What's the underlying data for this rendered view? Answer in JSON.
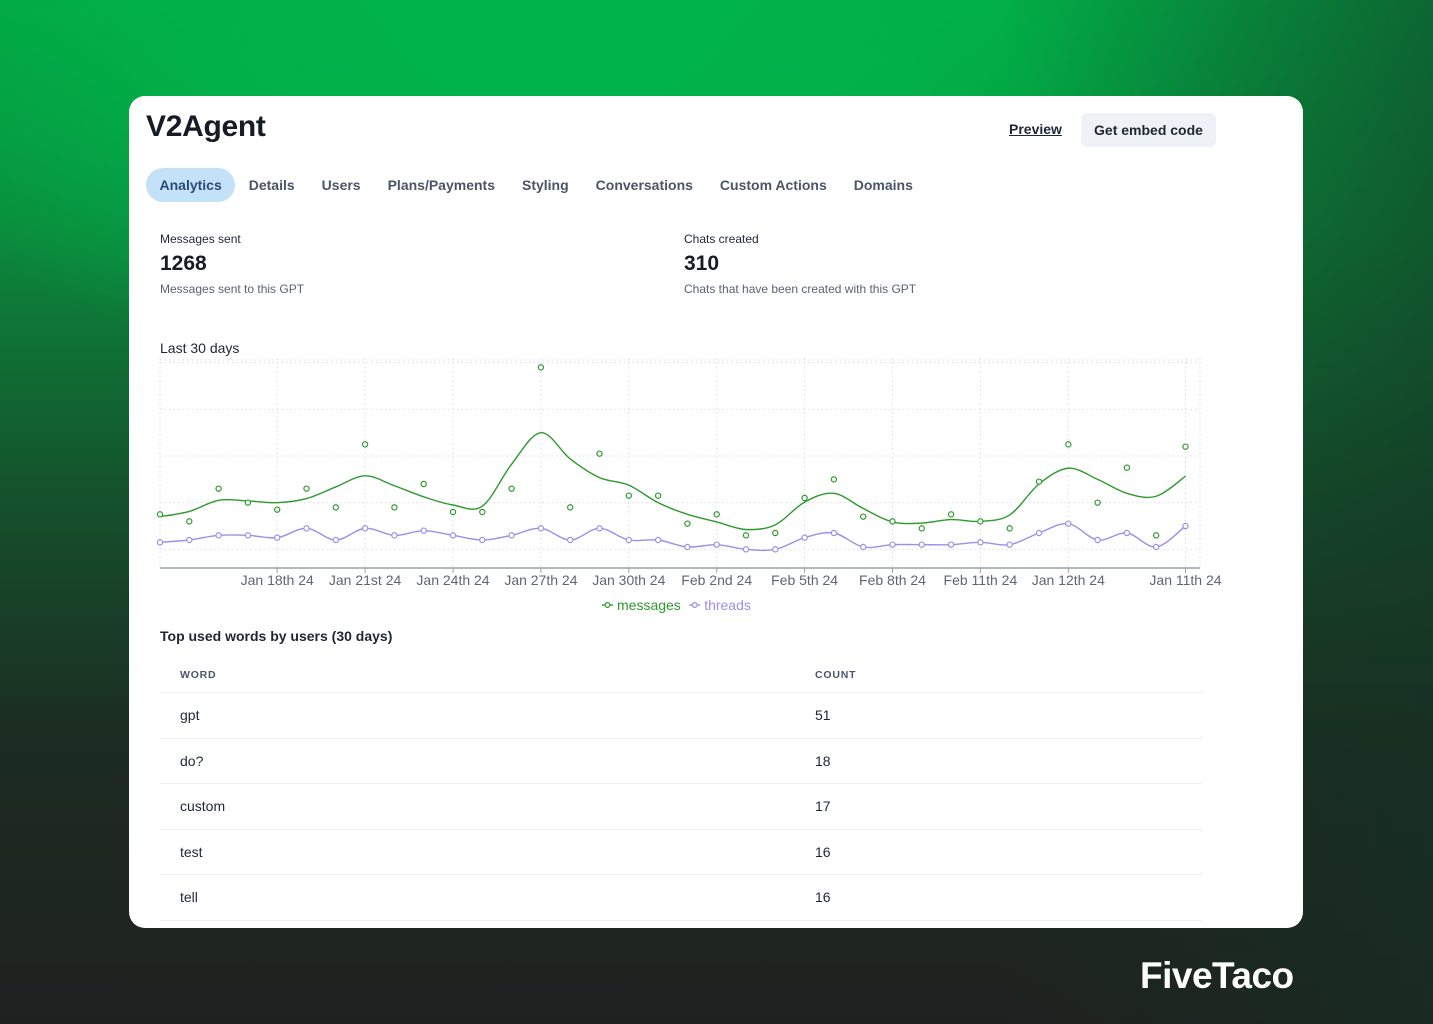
{
  "app": {
    "title": "V2Agent",
    "preview_label": "Preview",
    "embed_label": "Get embed code"
  },
  "tabs": [
    {
      "label": "Analytics",
      "active": true
    },
    {
      "label": "Details",
      "active": false
    },
    {
      "label": "Users",
      "active": false
    },
    {
      "label": "Plans/Payments",
      "active": false
    },
    {
      "label": "Styling",
      "active": false
    },
    {
      "label": "Conversations",
      "active": false
    },
    {
      "label": "Custom Actions",
      "active": false
    },
    {
      "label": "Domains",
      "active": false
    }
  ],
  "stats": {
    "messages": {
      "label": "Messages sent",
      "value": "1268",
      "description": "Messages sent to this GPT"
    },
    "chats": {
      "label": "Chats created",
      "value": "310",
      "description": "Chats that have been created with this GPT"
    }
  },
  "chart_data": {
    "type": "line",
    "title": "Last 30 days",
    "xlabel": "",
    "ylabel": "",
    "grid": true,
    "legend_position": "bottom-center",
    "x_index": [
      0,
      1,
      2,
      3,
      4,
      5,
      6,
      7,
      8,
      9,
      10,
      11,
      12,
      13,
      14,
      15,
      16,
      17,
      18,
      19,
      20,
      21,
      22,
      23,
      24,
      25,
      26,
      27,
      28,
      29,
      30,
      31,
      32,
      33,
      34,
      35
    ],
    "tick_labels": [
      {
        "index": 4,
        "label": "Jan 18th 24"
      },
      {
        "index": 7,
        "label": "Jan 21st 24"
      },
      {
        "index": 10,
        "label": "Jan 24th 24"
      },
      {
        "index": 13,
        "label": "Jan 27th 24"
      },
      {
        "index": 16,
        "label": "Jan 30th 24"
      },
      {
        "index": 19,
        "label": "Feb 2nd 24"
      },
      {
        "index": 22,
        "label": "Feb 5th 24"
      },
      {
        "index": 25,
        "label": "Feb 8th 24"
      },
      {
        "index": 28,
        "label": "Feb 11th 24"
      },
      {
        "index": 31,
        "label": "Jan 12th 24"
      },
      {
        "index": 35,
        "label": "Jan 11th 24"
      }
    ],
    "ylim": [
      0,
      90
    ],
    "y_grid_step": 20,
    "series": [
      {
        "name": "messages",
        "color": "#2e9a2e",
        "smoothed": true,
        "values": [
          23,
          20,
          34,
          28,
          25,
          34,
          26,
          53,
          26,
          36,
          24,
          24,
          34,
          86,
          26,
          49,
          31,
          31,
          19,
          23,
          14,
          15,
          30,
          38,
          22,
          20,
          17,
          23,
          20,
          17,
          37,
          53,
          28,
          43,
          14,
          52
        ]
      },
      {
        "name": "threads",
        "color": "#9b8fe8",
        "smoothed": false,
        "values": [
          11,
          12,
          14,
          14,
          13,
          17,
          12,
          17,
          14,
          16,
          14,
          12,
          14,
          17,
          12,
          17,
          12,
          12,
          9,
          10,
          8,
          8,
          13,
          15,
          9,
          10,
          10,
          10,
          11,
          10,
          15,
          19,
          12,
          15,
          9,
          18
        ]
      }
    ]
  },
  "top_words": {
    "title": "Top used words by users (30 days)",
    "columns": [
      "WORD",
      "COUNT"
    ],
    "rows": [
      {
        "word": "gpt",
        "count": "51"
      },
      {
        "word": "do?",
        "count": "18"
      },
      {
        "word": "custom",
        "count": "17"
      },
      {
        "word": "test",
        "count": "16"
      },
      {
        "word": "tell",
        "count": "16"
      }
    ]
  },
  "brand": {
    "name": "FiveTaco"
  }
}
